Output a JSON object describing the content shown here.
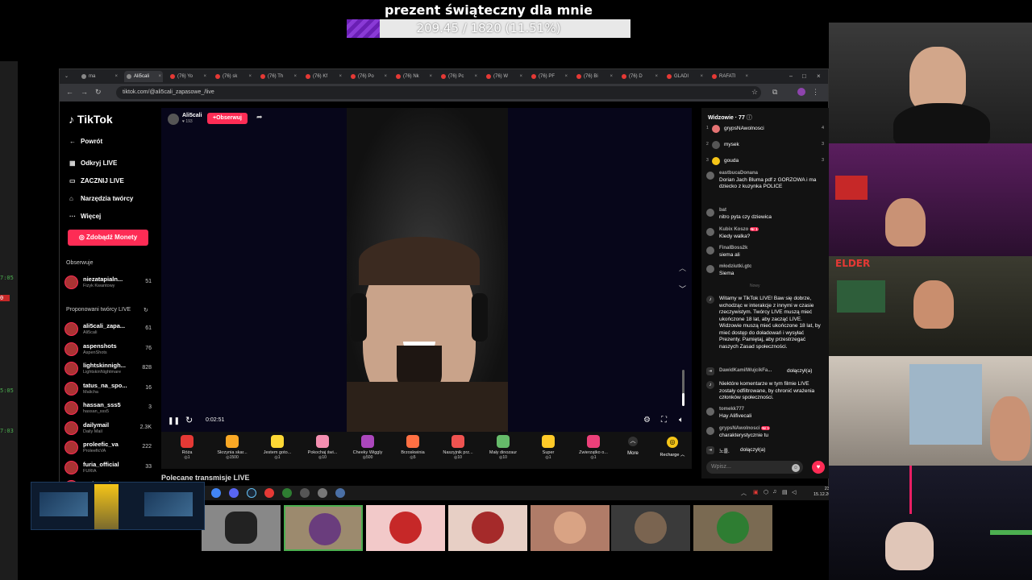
{
  "goal": {
    "title": "prezent świąteczny dla mnie",
    "progress_text": "209.45 / 1820 (11.51%)",
    "progress_fraction": 0.1151,
    "fill_color": "#7b2fc9"
  },
  "browser": {
    "tabs": [
      "ma",
      "Ali5cali",
      "(76) Yo",
      "(76) sk",
      "(76) Th",
      "(76) Kf",
      "(76) Po",
      "(76) Nk",
      "(76) Pc",
      "(76) W",
      "(76) PF",
      "(76) Bi",
      "(76) D",
      "GLADI",
      "RAFATI"
    ],
    "url": "tiktok.com/@ali5cali_zapasowe_/live"
  },
  "tiktok": {
    "logo": "TikTok",
    "nav": [
      "Powrót",
      "Odkryj LIVE",
      "ZACZNIJ LIVE",
      "Narzędzia twórcy",
      "Więcej"
    ],
    "coins_button": "Zdobądź Monety",
    "following_header": "Obserwuje",
    "following": [
      {
        "name": "niezatapialn...",
        "sub": "Fizyk Kwantowy",
        "count": "51"
      }
    ],
    "suggested_header": "Proponowani twórcy LIVE",
    "suggested": [
      {
        "name": "ali5cali_zapa...",
        "sub": "Ali5cali",
        "count": "61"
      },
      {
        "name": "aspenshots",
        "sub": "AspenShots",
        "count": "76"
      },
      {
        "name": "lightskinnigh...",
        "sub": "LightskinNightmare",
        "count": "828"
      },
      {
        "name": "tatus_na_spo...",
        "sub": "Malicha",
        "count": "16"
      },
      {
        "name": "hassan_sss5",
        "sub": "hassan_sss5",
        "count": "3"
      },
      {
        "name": "dailymail",
        "sub": "Daily Mail",
        "count": "2.3K"
      },
      {
        "name": "proleefic_va",
        "sub": "ProleeficVA",
        "count": "222"
      },
      {
        "name": "furia_official",
        "sub": "FURIA",
        "count": "33"
      },
      {
        "name": "codetroniy",
        "sub": "",
        "count": ""
      }
    ]
  },
  "stream": {
    "host_name": "Ali5cali",
    "host_likes": "193",
    "follow_label": "Obserwuj",
    "time": "0:02:51",
    "volume_fraction": 0.35,
    "below_title": "Polecane transmisje LIVE"
  },
  "gifts": [
    {
      "name": "Róża",
      "price": "1",
      "color": "#e53935"
    },
    {
      "name": "Skrzynia skar...",
      "price": "1500",
      "color": "#f9a825"
    },
    {
      "name": "Jestem goto...",
      "price": "1",
      "color": "#fdd835"
    },
    {
      "name": "Pokochaj świ...",
      "price": "10",
      "color": "#f48fb1"
    },
    {
      "name": "Cheeky Wiggly",
      "price": "500",
      "color": "#ab47bc"
    },
    {
      "name": "Brzoskwinia",
      "price": "5",
      "color": "#ff7043"
    },
    {
      "name": "Naszyjnik prz...",
      "price": "10",
      "color": "#ef5350"
    },
    {
      "name": "Mały dinozaur",
      "price": "10",
      "color": "#66bb6a"
    },
    {
      "name": "Super",
      "price": "1",
      "color": "#ffca28"
    },
    {
      "name": "Zwierzątko o...",
      "price": "1",
      "color": "#ec407a"
    }
  ],
  "gift_more": "More",
  "recharge": "Recharge",
  "chat": {
    "viewers_label": "Widzowie · 77",
    "top_viewers": [
      {
        "rank": "1",
        "name": "grypsNAwolnosci",
        "score": "4"
      },
      {
        "rank": "2",
        "name": "mysek",
        "score": "3"
      },
      {
        "rank": "3",
        "name": "gouda",
        "score": "3"
      }
    ],
    "messages": [
      {
        "user": "eastbucaDonana",
        "text": "Dorian Jach Bluma pdf z GORZOWA i ma dziecko z kuzynka POLICE",
        "badge": ""
      },
      {
        "user": "bat",
        "text": "nitro pyta czy dziewica",
        "badge": ""
      },
      {
        "user": "Kubix Koszo",
        "text": "Kiedy walka?",
        "badge": "Nr 1"
      },
      {
        "user": "FinalBoss2k",
        "text": "siema ali",
        "badge": ""
      },
      {
        "user": "młodziutki.gtc",
        "text": "Siema",
        "badge": ""
      }
    ],
    "separator": "Nowy",
    "system_welcome": "Witamy w TikTok LIVE! Baw się dobrze, wchodząc w interakcje z innymi w czasie rzeczywistym. Twórcy LIVE muszą mieć ukończone 18 lat, aby zacząć LIVE. Widzowie muszą mieć ukończone 18 lat, by mieć dostęp do doładowań i wysyłać Prezenty. Pamiętaj, aby przestrzegać naszych Zasad społeczności.",
    "join1_user": "DawidKamilWujcikFa...",
    "join1_text": "dołączył(a)",
    "system_filter": "Niektóre komentarze w tym filmie LIVE zostały odfiltrowane, by chronić wrażenia członków społeczności.",
    "messages2": [
      {
        "user": "tomekk777",
        "text": "Hay Alifivecali",
        "badge": ""
      },
      {
        "user": "grypsNAwolnosci",
        "text": "charakterystycznie tu",
        "badge": "Nr 1"
      }
    ],
    "join2_user": "노를.",
    "join2_text": "dołączył(a)",
    "input_placeholder": "Wpisz..."
  },
  "taskbar": {
    "time": "23:45",
    "date": "15.12.2025"
  },
  "overlay": {
    "elder_tag": "ELDER"
  }
}
